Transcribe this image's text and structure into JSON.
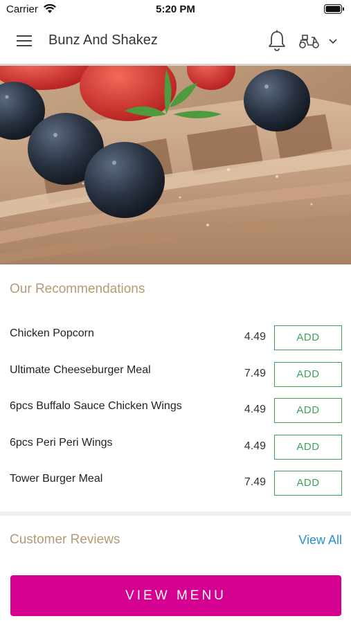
{
  "status_bar": {
    "carrier": "Carrier",
    "time": "5:20 PM"
  },
  "header": {
    "title": "Bunz And Shakez",
    "icons": [
      "menu-icon",
      "bell-icon",
      "scooter-icon",
      "chevron-down-icon"
    ]
  },
  "hero": {
    "description_icon": "waffle-photo"
  },
  "recommendations": {
    "title": "Our Recommendations",
    "items": [
      {
        "name": "Chicken Popcorn",
        "price": "4.49",
        "button": "ADD"
      },
      {
        "name": "Ultimate Cheeseburger Meal",
        "price": "7.49",
        "button": "ADD"
      },
      {
        "name": "6pcs Buffalo Sauce Chicken Wings",
        "price": "4.49",
        "button": "ADD"
      },
      {
        "name": "6pcs Peri Peri Wings",
        "price": "4.49",
        "button": "ADD"
      },
      {
        "name": "Tower Burger Meal",
        "price": "7.49",
        "button": "ADD"
      }
    ]
  },
  "reviews": {
    "title": "Customer Reviews",
    "view_all": "View All"
  },
  "footer": {
    "view_menu": "VIEW MENU"
  },
  "colors": {
    "accent": "#d4008f",
    "add_green": "#3fa05a",
    "section_title": "#b59a72",
    "link": "#2b8fcf"
  }
}
